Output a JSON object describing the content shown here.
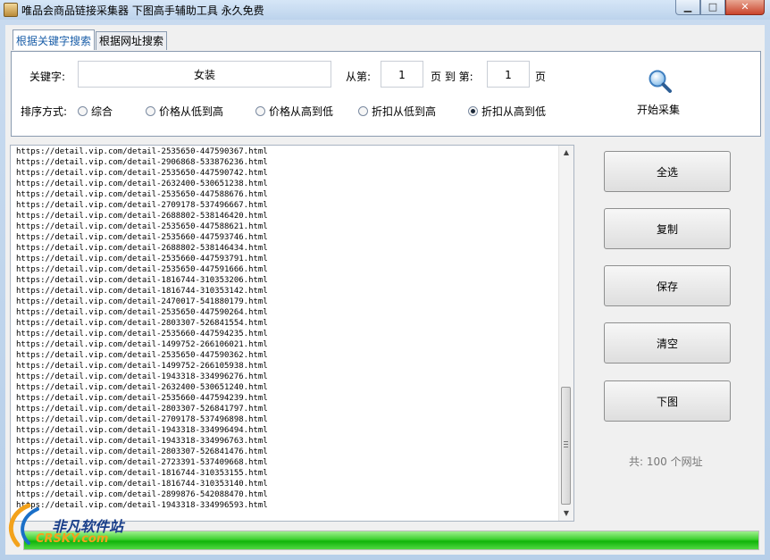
{
  "window": {
    "title": "唯品会商品链接采集器  下图高手辅助工具  永久免费",
    "btn_min": "▁",
    "btn_max": "□",
    "btn_close": "✕"
  },
  "tabs": [
    {
      "label": "根据关键字搜索",
      "active": true
    },
    {
      "label": "根据网址搜索",
      "active": false
    }
  ],
  "search": {
    "keyword_label": "关键字:",
    "keyword_value": "女装",
    "from_label": "从第:",
    "from_value": "1",
    "page_to_label": "页 到 第:",
    "to_value": "1",
    "page_label": "页",
    "sort_label": "排序方式:",
    "sort_options": [
      {
        "label": "综合",
        "selected": false
      },
      {
        "label": "价格从低到高",
        "selected": false
      },
      {
        "label": "价格从高到低",
        "selected": false
      },
      {
        "label": "折扣从低到高",
        "selected": false
      },
      {
        "label": "折扣从高到低",
        "selected": true
      }
    ],
    "start_icon": "magnifier-icon",
    "start_label": "开始采集"
  },
  "urls": [
    "https://detail.vip.com/detail-2535650-447590367.html",
    "https://detail.vip.com/detail-2906868-533876236.html",
    "https://detail.vip.com/detail-2535650-447590742.html",
    "https://detail.vip.com/detail-2632400-530651238.html",
    "https://detail.vip.com/detail-2535650-447588676.html",
    "https://detail.vip.com/detail-2709178-537496667.html",
    "https://detail.vip.com/detail-2688802-538146420.html",
    "https://detail.vip.com/detail-2535650-447588621.html",
    "https://detail.vip.com/detail-2535660-447593746.html",
    "https://detail.vip.com/detail-2688802-538146434.html",
    "https://detail.vip.com/detail-2535660-447593791.html",
    "https://detail.vip.com/detail-2535650-447591666.html",
    "https://detail.vip.com/detail-1816744-310353206.html",
    "https://detail.vip.com/detail-1816744-310353142.html",
    "https://detail.vip.com/detail-2470017-541880179.html",
    "https://detail.vip.com/detail-2535650-447590264.html",
    "https://detail.vip.com/detail-2803307-526841554.html",
    "https://detail.vip.com/detail-2535660-447594235.html",
    "https://detail.vip.com/detail-1499752-266106021.html",
    "https://detail.vip.com/detail-2535650-447590362.html",
    "https://detail.vip.com/detail-1499752-266105938.html",
    "https://detail.vip.com/detail-1943318-334996276.html",
    "https://detail.vip.com/detail-2632400-530651240.html",
    "https://detail.vip.com/detail-2535660-447594239.html",
    "https://detail.vip.com/detail-2803307-526841797.html",
    "https://detail.vip.com/detail-2709178-537496898.html",
    "https://detail.vip.com/detail-1943318-334996494.html",
    "https://detail.vip.com/detail-1943318-334996763.html",
    "https://detail.vip.com/detail-2803307-526841476.html",
    "https://detail.vip.com/detail-2723391-537409668.html",
    "https://detail.vip.com/detail-1816744-310353155.html",
    "https://detail.vip.com/detail-1816744-310353140.html",
    "https://detail.vip.com/detail-2899876-542088470.html",
    "https://detail.vip.com/detail-1943318-334996593.html"
  ],
  "actions": {
    "select_all": "全选",
    "copy": "复制",
    "save": "保存",
    "clear": "清空",
    "download": "下图"
  },
  "status": {
    "count_text": "共: 100 个网址"
  },
  "progress": {
    "value_percent": 100
  },
  "watermark": {
    "cn": "非凡软件站",
    "en": "CRSKY.com"
  }
}
